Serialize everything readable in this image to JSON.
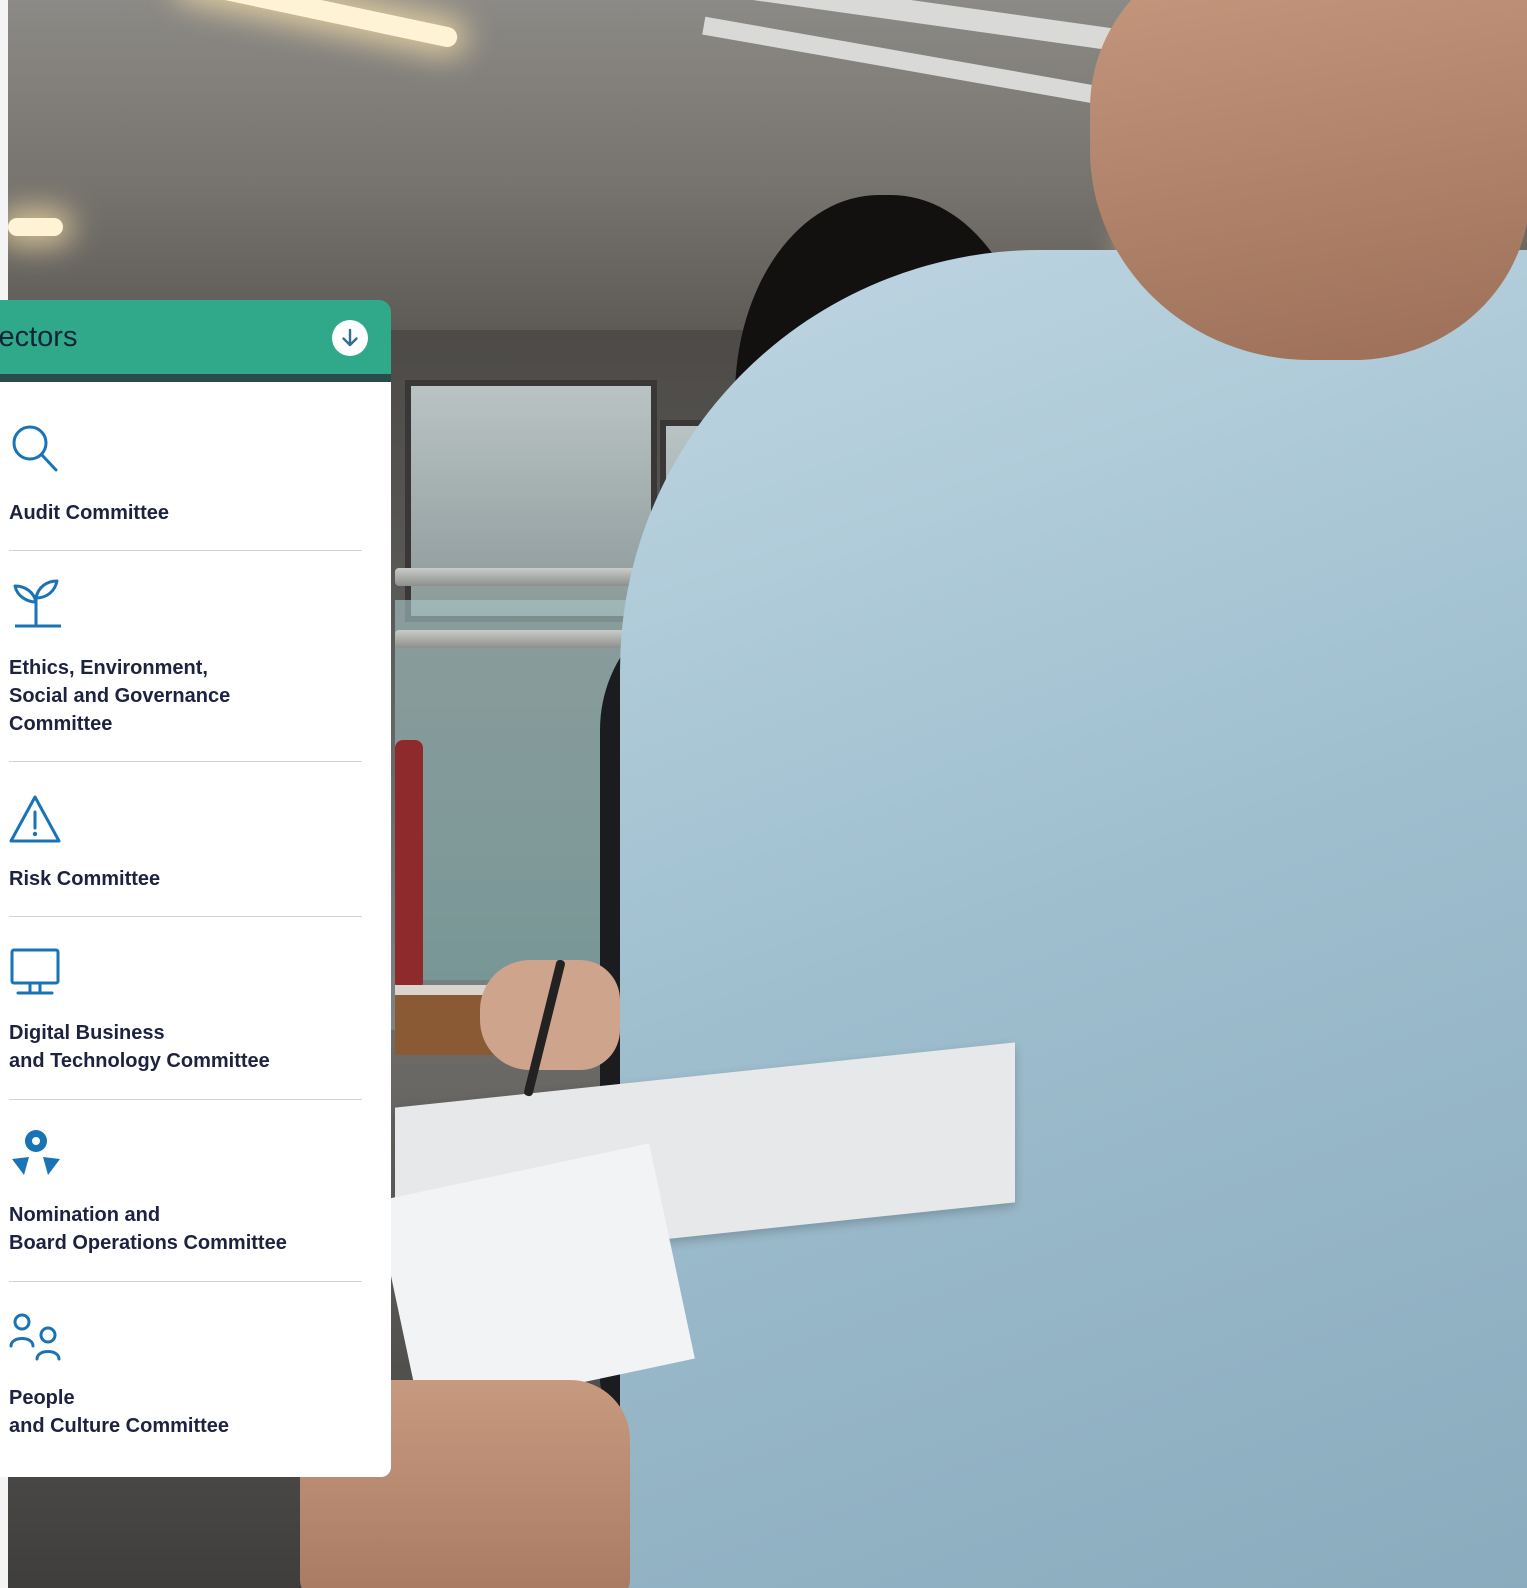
{
  "panel": {
    "title": "d of Directors",
    "toggle_icon": "arrow-down-circle-icon",
    "header_color": "#2fa98a",
    "icon_color": "#1a73b5",
    "committees": [
      {
        "icon": "search-icon",
        "lines": [
          "Audit Committee"
        ]
      },
      {
        "icon": "sprout-icon",
        "lines": [
          "Ethics, Environment,",
          "Social and Governance",
          "Committee"
        ]
      },
      {
        "icon": "warning-icon",
        "lines": [
          "Risk Committee"
        ]
      },
      {
        "icon": "monitor-icon",
        "lines": [
          "Digital Business",
          "and Technology Committee"
        ]
      },
      {
        "icon": "nomination-icon",
        "lines": [
          "Nomination and",
          "Board Operations Committee"
        ]
      },
      {
        "icon": "people-icon",
        "lines": [
          "People",
          "and Culture Committee"
        ]
      }
    ]
  }
}
